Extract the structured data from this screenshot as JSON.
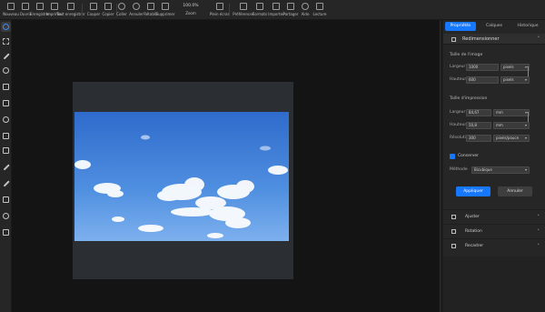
{
  "toolbar": {
    "items": [
      {
        "label": "Nouveau",
        "icon": "new-file-icon"
      },
      {
        "label": "Ouvrir",
        "icon": "open-folder-icon"
      },
      {
        "label": "Enregistrer",
        "icon": "save-icon"
      },
      {
        "label": "Imprimer",
        "icon": "print-icon"
      },
      {
        "label": "Tout enregistrer",
        "icon": "save-all-icon"
      },
      {
        "label": "Couper",
        "icon": "cut-icon"
      },
      {
        "label": "Copier",
        "icon": "copy-icon"
      },
      {
        "label": "Coller",
        "icon": "paste-icon"
      },
      {
        "label": "Annuler",
        "icon": "undo-icon"
      },
      {
        "label": "Rétablir",
        "icon": "redo-icon"
      },
      {
        "label": "Supprimer",
        "icon": "delete-icon"
      },
      {
        "label": "Plein écran",
        "icon": "fullscreen-icon"
      }
    ],
    "zoom_value": "100.0%",
    "zoom_label": "Zoom",
    "items_right": [
      {
        "label": "Préférences",
        "icon": "settings-icon"
      },
      {
        "label": "Formats",
        "icon": "formats-icon"
      },
      {
        "label": "Importer",
        "icon": "import-icon"
      },
      {
        "label": "Partager",
        "icon": "share-icon"
      },
      {
        "label": "Aide",
        "icon": "help-icon"
      },
      {
        "label": "Lecture",
        "icon": "play-icon"
      }
    ]
  },
  "tools": [
    "logo-icon",
    "marquee-icon",
    "magic-wand-icon",
    "lasso-icon",
    "crop-icon",
    "image-icon",
    "dropper-icon",
    "stamp-icon",
    "eraser-icon",
    "brush-icon",
    "pen-icon",
    "shape-icon",
    "hand-icon",
    "zoom-icon"
  ],
  "panel": {
    "tabs": [
      "Propriétés",
      "Calques",
      "Historique"
    ],
    "active_tab": 0,
    "section_title": "Redimensionner",
    "image_size": {
      "title": "Taille de l'image",
      "width_label": "Largeur",
      "width_value": "1000",
      "width_unit": "pixels",
      "height_label": "Hauteur",
      "height_value": "600",
      "height_unit": "pixels"
    },
    "print_size": {
      "title": "Taille d'impression",
      "width_label": "Largeur",
      "width_value": "84,67",
      "width_unit": "mm",
      "height_label": "Hauteur",
      "height_value": "50,8",
      "height_unit": "mm",
      "resolution_label": "Résolution",
      "resolution_value": "300",
      "resolution_unit": "pixels/pouce"
    },
    "keep_ratio_label": "Conserver",
    "keep_ratio_checked": true,
    "resample_label": "Méthode",
    "resample_value": "Bicubique",
    "apply_label": "Appliquer",
    "cancel_label": "Annuler",
    "collapsed_sections": [
      {
        "label": "Ajuster",
        "icon": "adjust-icon"
      },
      {
        "label": "Rotation",
        "icon": "rotate-icon"
      },
      {
        "label": "Recadrer",
        "icon": "crop-icon"
      }
    ]
  },
  "colors": {
    "accent": "#1677ff",
    "background": "#141414",
    "panel": "#262626",
    "sky_top": "#2f6bcc",
    "sky_bottom": "#7db0ee"
  }
}
